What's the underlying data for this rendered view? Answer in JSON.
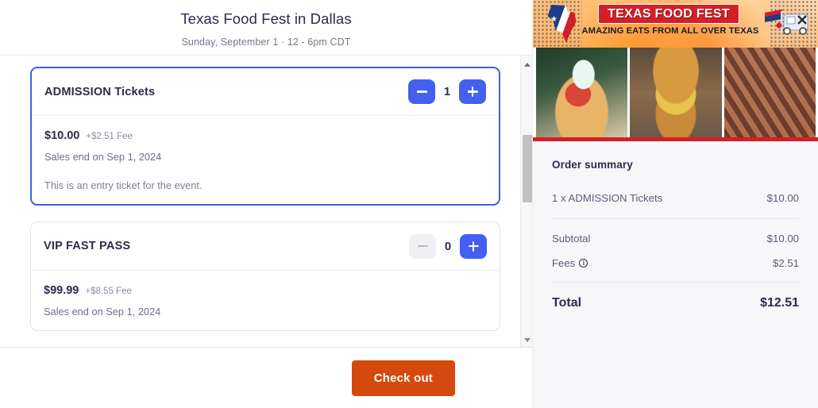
{
  "event": {
    "title": "Texas Food Fest in Dallas",
    "datetime": "Sunday, September 1 · 12 - 6pm CDT"
  },
  "tickets": [
    {
      "name": "ADMISSION Tickets",
      "quantity": "1",
      "price": "$10.00",
      "fee": "+$2.51 Fee",
      "sales_end": "Sales end on Sep 1, 2024",
      "description": "This is an entry ticket for the event.",
      "decrement_label": "−",
      "increment_label": "+"
    },
    {
      "name": "VIP FAST PASS",
      "quantity": "0",
      "price": "$99.99",
      "fee": "+$8.55 Fee",
      "sales_end": "Sales end on Sep 1, 2024",
      "description": "",
      "decrement_label": "−",
      "increment_label": "+"
    }
  ],
  "footer": {
    "checkout_label": "Check out"
  },
  "banner": {
    "title": "TEXAS FOOD FEST",
    "subtitle": "AMAZING EATS FROM ALL OVER TEXAS"
  },
  "summary": {
    "title": "Order summary",
    "line_items": [
      {
        "label": "1 x ADMISSION Tickets",
        "value": "$10.00"
      }
    ],
    "subtotal_label": "Subtotal",
    "subtotal_value": "$10.00",
    "fees_label": "Fees",
    "fees_info_glyph": "i",
    "fees_value": "$2.51",
    "total_label": "Total",
    "total_value": "$12.51"
  },
  "colors": {
    "accent_blue": "#4361EE",
    "checkout_orange": "#D4490D",
    "banner_red": "#D51F26",
    "text_dark": "#2D2B4E"
  }
}
